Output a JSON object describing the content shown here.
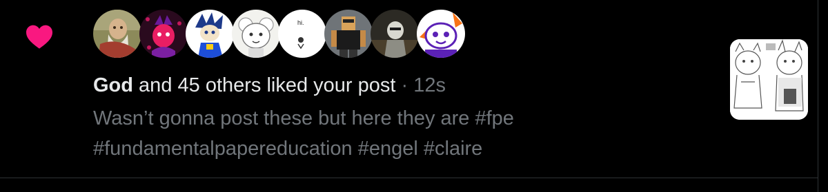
{
  "colors": {
    "background": "#000000",
    "heart": "#f91880",
    "primary_text": "#e7e9ea",
    "secondary_text": "#71767b",
    "divider": "#2f3336"
  },
  "icons": {
    "notification_type": "heart-icon"
  },
  "notification": {
    "actor": "God",
    "summary_rest": " and 45 others liked your post",
    "separator": " · ",
    "time": "12s",
    "post_text": "Wasn’t gonna post these but here they are #fpe #fundamentalpapereducation #engel #claire",
    "avatars": [
      "avatar-painting",
      "avatar-red-character",
      "avatar-blue-character",
      "avatar-white-character",
      "avatar-text-sketch",
      "avatar-blocky-figure",
      "avatar-dark-figure",
      "avatar-cartoon-face"
    ],
    "avatar_sketch_text": "hi."
  }
}
